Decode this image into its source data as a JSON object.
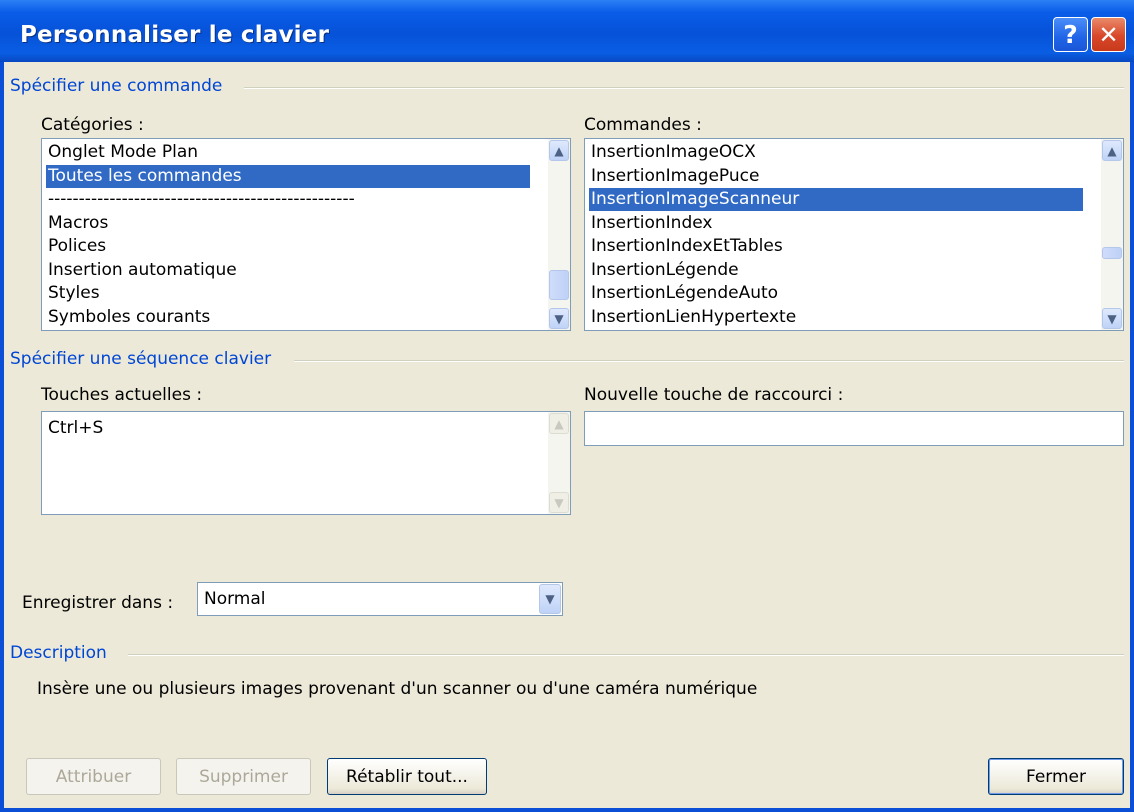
{
  "window": {
    "title": "Personnaliser le clavier",
    "help_glyph": "?",
    "close_glyph": "✕"
  },
  "command_section": {
    "header": "Spécifier une commande",
    "categories_label": "Catégories :",
    "categories": [
      "Onglet Mode Plan",
      "Toutes les commandes",
      "--------------------------------------------------",
      "Macros",
      "Polices",
      "Insertion automatique",
      "Styles",
      "Symboles courants"
    ],
    "categories_selected": 1,
    "commands_label": "Commandes :",
    "commands": [
      "InsertionImageOCX",
      "InsertionImagePuce",
      "InsertionImageScanneur",
      "InsertionIndex",
      "InsertionIndexEtTables",
      "InsertionLégende",
      "InsertionLégendeAuto",
      "InsertionLienHypertexte"
    ],
    "commands_selected": 2
  },
  "key_section": {
    "header": "Spécifier une séquence clavier",
    "current_keys_label": "Touches actuelles :",
    "current_keys": [
      "Ctrl+S"
    ],
    "new_shortcut_label": "Nouvelle touche de raccourci :",
    "new_shortcut_value": ""
  },
  "save_in": {
    "label": "Enregistrer dans :",
    "value": "Normal"
  },
  "description": {
    "header": "Description",
    "text": "Insère une ou plusieurs images provenant d'un scanner ou d'une caméra numérique"
  },
  "buttons": {
    "assign": "Attribuer",
    "remove": "Supprimer",
    "reset_all": "Rétablir tout...",
    "close": "Fermer"
  },
  "icons": {
    "scroll_up": "▲",
    "scroll_down": "▼",
    "dropdown": "▼"
  }
}
